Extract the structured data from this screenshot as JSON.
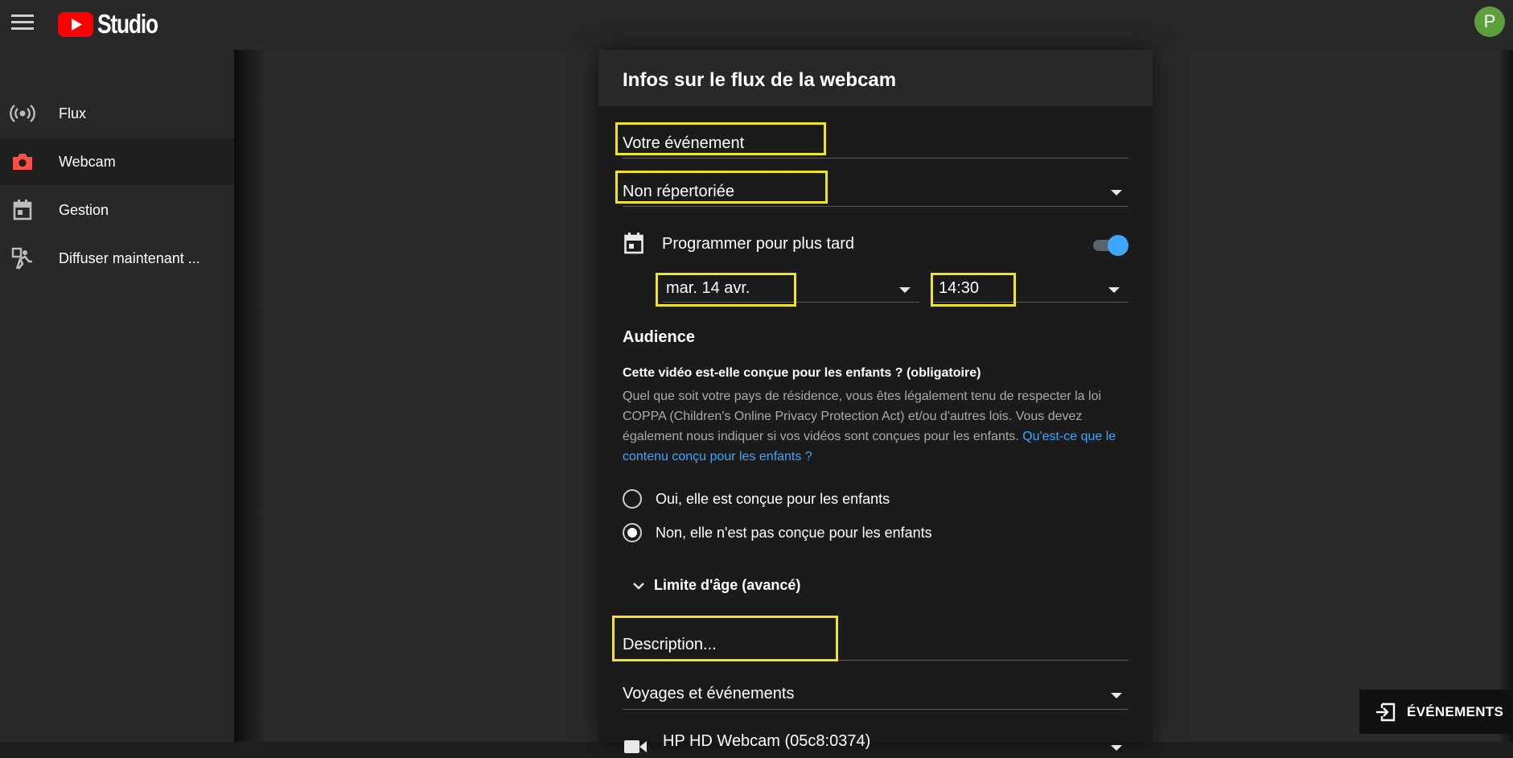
{
  "app": {
    "title": "Studio",
    "avatar_letter": "P"
  },
  "sidebar": {
    "items": [
      {
        "label": "Flux",
        "icon": "broadcast-icon",
        "active": false
      },
      {
        "label": "Webcam",
        "icon": "camera-icon",
        "active": true
      },
      {
        "label": "Gestion",
        "icon": "calendar-icon",
        "active": false
      },
      {
        "label": "Diffuser maintenant ...",
        "icon": "stream-now-icon",
        "active": false
      }
    ]
  },
  "dialog": {
    "title": "Infos sur le flux de la webcam",
    "event_title": "Votre événement",
    "visibility": "Non répertoriée",
    "schedule_label": "Programmer pour plus tard",
    "schedule_enabled": true,
    "date": "mar. 14 avr.",
    "time": "14:30",
    "audience_title": "Audience",
    "audience_question": "Cette vidéo est-elle conçue pour les enfants ? (obligatoire)",
    "audience_text": "Quel que soit votre pays de résidence, vous êtes légalement tenu de respecter la loi COPPA (Children's Online Privacy Protection Act) et/ou d'autres lois. Vous devez également nous indiquer si vos vidéos sont conçues pour les enfants. ",
    "audience_link": "Qu'est-ce que le contenu conçu pour les enfants ?",
    "radio_yes": "Oui, elle est conçue pour les enfants",
    "radio_no": "Non, elle n'est pas conçue pour les enfants",
    "radio_selected": "no",
    "age_limit": "Limite d'âge (avancé)",
    "description_placeholder": "Description...",
    "category": "Voyages et événements",
    "camera": "HP HD Webcam (05c8:0374)"
  },
  "events_button": {
    "label": "ÉVÉNEMENTS"
  },
  "colors": {
    "accent": "#3ea6ff",
    "highlight": "#f0e428",
    "brand_red": "#ff0000",
    "avatar": "#5d9f3a"
  }
}
